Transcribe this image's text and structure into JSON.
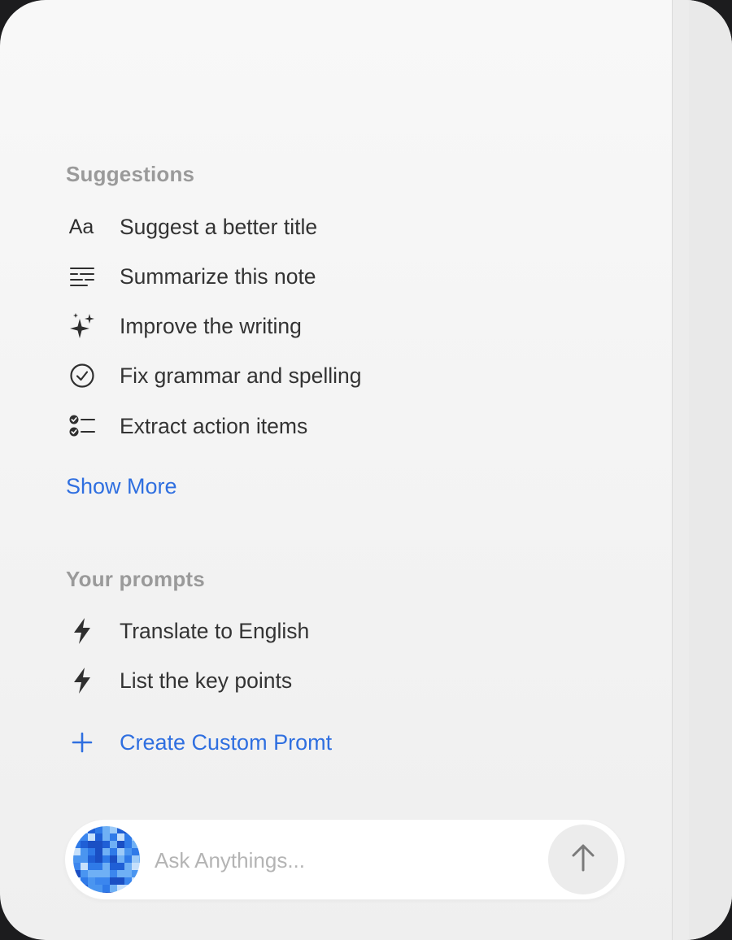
{
  "suggestions": {
    "title": "Suggestions",
    "items": [
      {
        "icon": "text-format-icon",
        "icon_text": "Aa",
        "label": "Suggest a better title"
      },
      {
        "icon": "summary-lines-icon",
        "label": "Summarize this note"
      },
      {
        "icon": "sparkles-icon",
        "label": "Improve the writing"
      },
      {
        "icon": "check-circle-icon",
        "label": "Fix grammar and spelling"
      },
      {
        "icon": "checklist-icon",
        "label": "Extract action items"
      }
    ],
    "show_more_label": "Show More"
  },
  "prompts": {
    "title": "Your prompts",
    "items": [
      {
        "icon": "lightning-icon",
        "label": "Translate to English"
      },
      {
        "icon": "lightning-icon",
        "label": "List the key points"
      }
    ],
    "create_label": "Create Custom Promt"
  },
  "composer": {
    "placeholder": "Ask Anythings...",
    "value": "",
    "send_icon": "arrow-up-icon",
    "accent_color": "#2f6fe0"
  }
}
